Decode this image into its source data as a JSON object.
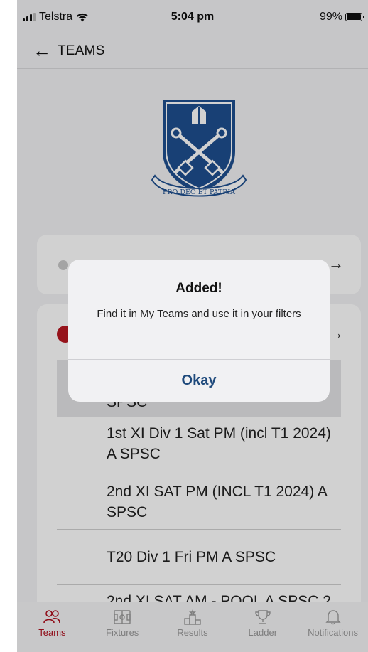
{
  "status_bar": {
    "carrier": "Telstra",
    "time": "5:04 pm",
    "battery": "99%",
    "battery_level": 0.99
  },
  "nav": {
    "title": "TEAMS"
  },
  "crest": {
    "motto": "PRO DEO ET PATRIA"
  },
  "teams": [
    {
      "name": "SPSC",
      "partial": true
    },
    {
      "name": "1st XI Div 1 Sat PM (incl T1 2024) A SPSC"
    },
    {
      "name": "2nd XI SAT PM (INCL T1 2024) A SPSC"
    },
    {
      "name": "T20 Div 1 Fri PM A SPSC"
    },
    {
      "name": "2nd XI SAT AM - POOL A SPSC 2"
    }
  ],
  "alert": {
    "title": "Added!",
    "message": "Find it in My Teams and use it in your filters",
    "button": "Okay"
  },
  "tabbar": {
    "items": [
      {
        "label": "Teams",
        "icon": "people-icon",
        "active": true
      },
      {
        "label": "Fixtures",
        "icon": "fixtures-icon",
        "active": false
      },
      {
        "label": "Results",
        "icon": "podium-icon",
        "active": false
      },
      {
        "label": "Ladder",
        "icon": "trophy-icon",
        "active": false
      },
      {
        "label": "Notifications",
        "icon": "bell-icon",
        "active": false
      }
    ]
  },
  "colors": {
    "accent": "#b0101e",
    "alert_button": "#1f4a7c",
    "crest_blue": "#1e4f8f"
  }
}
